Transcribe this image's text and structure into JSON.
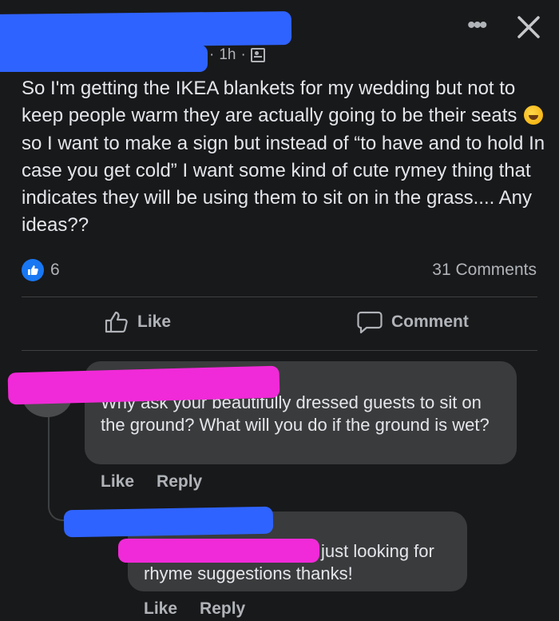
{
  "post": {
    "time": "1h",
    "separator": "·",
    "privacy_icon": "group-privacy-icon",
    "text_before_emoji": "So I'm getting the IKEA blankets for my wedding but not to keep people warm they are actually going to be their seats",
    "emoji": "rolling-on-floor-laughing-emoji",
    "text_after_emoji": "so I want to make a sign but instead of “to have and to hold In case you get cold” I want some kind of cute rymey thing that indicates they will be using them to sit on in the grass.... Any ideas??",
    "reaction_count": "6",
    "comment_count": "31 Comments"
  },
  "actions": {
    "like_label": "Like",
    "comment_label": "Comment"
  },
  "comments": [
    {
      "text": "Why ask your beautifully dressed guests to sit on the ground? What will you do if the ground is wet?",
      "like_label": "Like",
      "reply_label": "Reply"
    },
    {
      "text": "just looking for rhyme suggestions thanks!",
      "like_label": "Like",
      "reply_label": "Reply"
    }
  ],
  "colors": {
    "background": "#18191a",
    "bubble": "#3a3b3c",
    "like_blue": "#1877f2",
    "redaction_blue": "#2f63ff",
    "redaction_pink": "#f02ad8"
  }
}
